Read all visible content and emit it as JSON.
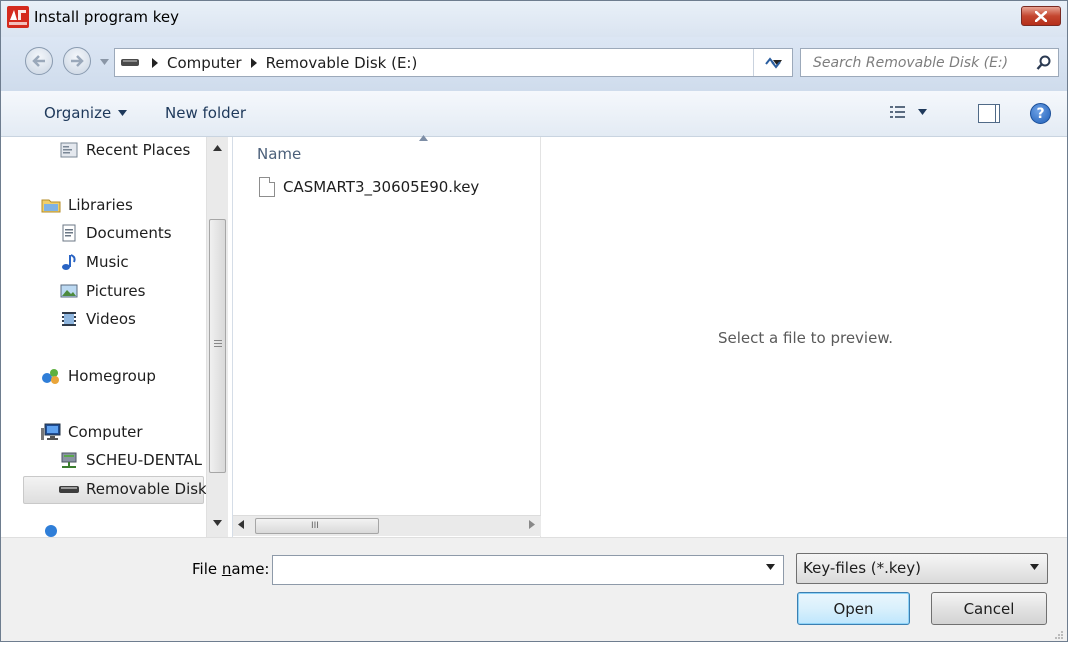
{
  "window": {
    "title": "Install program key"
  },
  "address": {
    "crumbs": [
      "Computer",
      "Removable Disk (E:)"
    ]
  },
  "search": {
    "placeholder": "Search Removable Disk (E:)"
  },
  "toolbar": {
    "organize_label": "Organize",
    "new_folder_label": "New folder"
  },
  "sidebar": {
    "items": [
      {
        "label": "Recent Places",
        "icon": "recent-places-icon"
      },
      {
        "label": "Libraries",
        "icon": "libraries-icon"
      },
      {
        "label": "Documents",
        "icon": "documents-icon"
      },
      {
        "label": "Music",
        "icon": "music-icon"
      },
      {
        "label": "Pictures",
        "icon": "pictures-icon"
      },
      {
        "label": "Videos",
        "icon": "videos-icon"
      },
      {
        "label": "Homegroup",
        "icon": "homegroup-icon"
      },
      {
        "label": "Computer",
        "icon": "computer-icon"
      },
      {
        "label": "SCHEU-DENTAL",
        "icon": "network-drive-icon"
      },
      {
        "label": "Removable Disk (",
        "icon": "removable-disk-icon"
      }
    ],
    "selected": "Removable Disk ("
  },
  "file_list": {
    "column_header": "Name",
    "files": [
      {
        "name": "CASMART3_30605E90.key",
        "icon": "file-icon"
      }
    ]
  },
  "preview": {
    "message": "Select a file to preview."
  },
  "bottom": {
    "file_name_label_pre": "File ",
    "file_name_label_underlined": "n",
    "file_name_label_post": "ame:",
    "file_name_value": "",
    "filter_value": "Key-files (*.key)",
    "open_label": "Open",
    "cancel_label": "Cancel"
  },
  "colors": {
    "titlebar": "#dae4f1",
    "close_button": "#c4462f",
    "accent_link": "#1e395b",
    "open_button_border": "#3c7fb1"
  }
}
